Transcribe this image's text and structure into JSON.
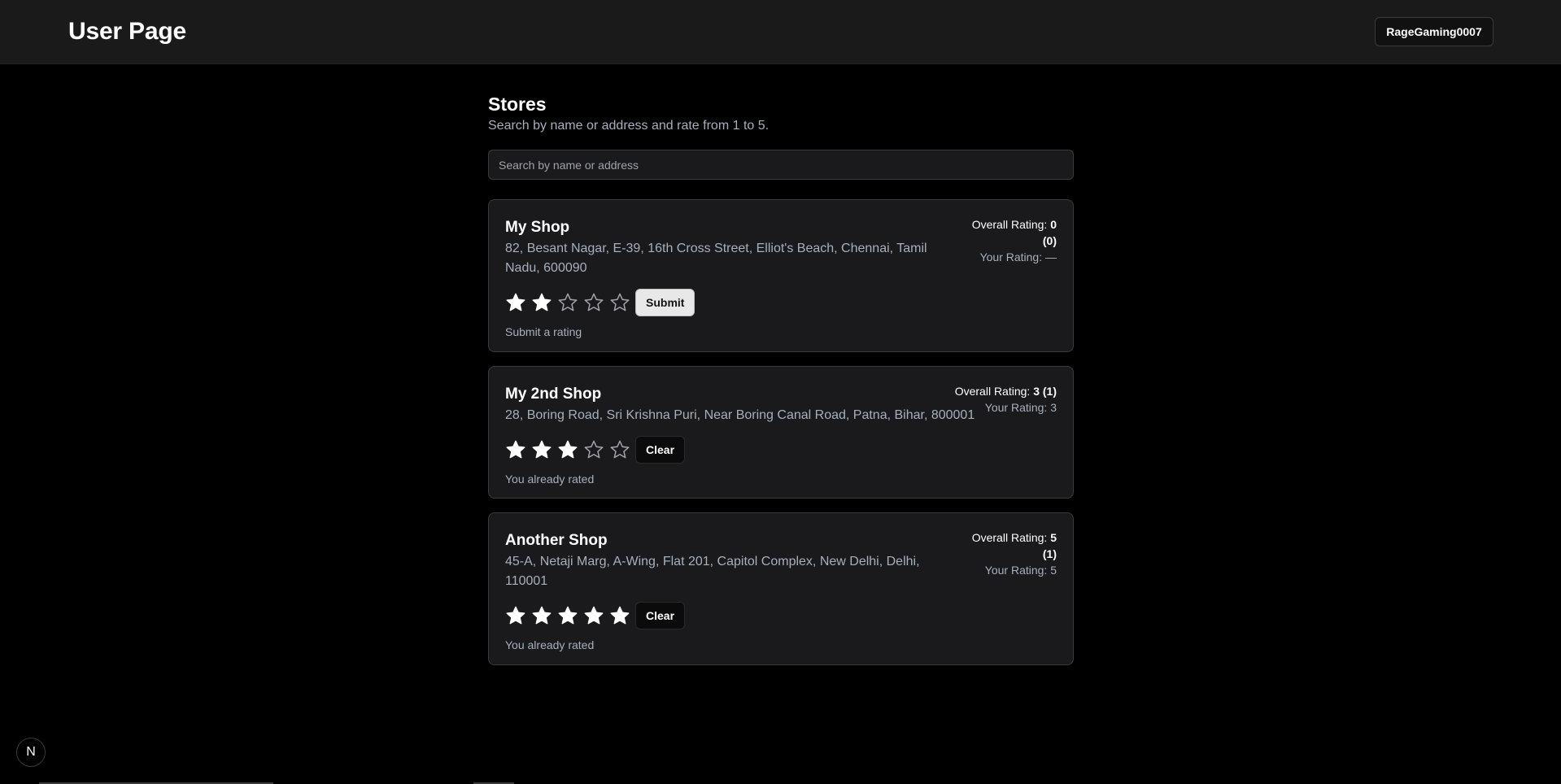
{
  "header": {
    "title": "User Page",
    "user_button_label": "RageGaming0007"
  },
  "main": {
    "title": "Stores",
    "subtitle": "Search by name or address and rate from 1 to 5.",
    "search_placeholder": "Search by name or address"
  },
  "stores": [
    {
      "name": "My Shop",
      "address": "82, Besant Nagar, E-39, 16th Cross Street, Elliot's Beach, Chennai, Tamil Nadu, 600090",
      "overall_label": "Overall Rating:",
      "overall_value": "0",
      "overall_count": "(0)",
      "your_rating_label": "Your Rating: —",
      "selected_stars": 2,
      "action_label": "Submit",
      "status": "Submit a rating"
    },
    {
      "name": "My 2nd Shop",
      "address": "28, Boring Road, Sri Krishna Puri, Near Boring Canal Road, Patna, Bihar, 800001",
      "overall_label": "Overall Rating:",
      "overall_value": "3",
      "overall_count": "(1)",
      "your_rating_label": "Your Rating: 3",
      "selected_stars": 3,
      "action_label": "Clear",
      "status": "You already rated"
    },
    {
      "name": "Another Shop",
      "address": "45-A, Netaji Marg, A-Wing, Flat 201, Capitol Complex, New Delhi, Delhi, 110001",
      "overall_label": "Overall Rating:",
      "overall_value": "5",
      "overall_count": "(1)",
      "your_rating_label": "Your Rating: 5",
      "selected_stars": 5,
      "action_label": "Clear",
      "status": "You already rated"
    }
  ],
  "dev_badge": {
    "label": "N",
    "icon": "nextjs-logo-icon"
  },
  "colors": {
    "background": "#000000",
    "topbar": "#1a1a1a",
    "card": "#1a1a1c",
    "muted_text": "#a7afbd",
    "star_filled": "#ffffff",
    "star_empty_stroke": "#a1a1aa"
  }
}
